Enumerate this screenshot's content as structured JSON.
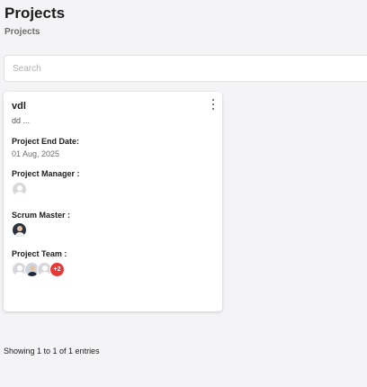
{
  "header": {
    "title": "Projects",
    "breadcrumb": "Projects"
  },
  "search": {
    "placeholder": "Search",
    "value": ""
  },
  "project_card": {
    "name": "vdl",
    "description": "dd ...",
    "end_date_label": "Project End Date:",
    "end_date": "01 Aug, 2025",
    "manager_label": "Project Manager :",
    "scrum_master_label": "Scrum Master :",
    "team_label": "Project Team :",
    "team_more_count": "+2",
    "menu_icon": "more-vertical-icon",
    "more_badge_color": "#e53935"
  },
  "footer": {
    "entries_text": "Showing 1 to 1 of 1 entries"
  }
}
